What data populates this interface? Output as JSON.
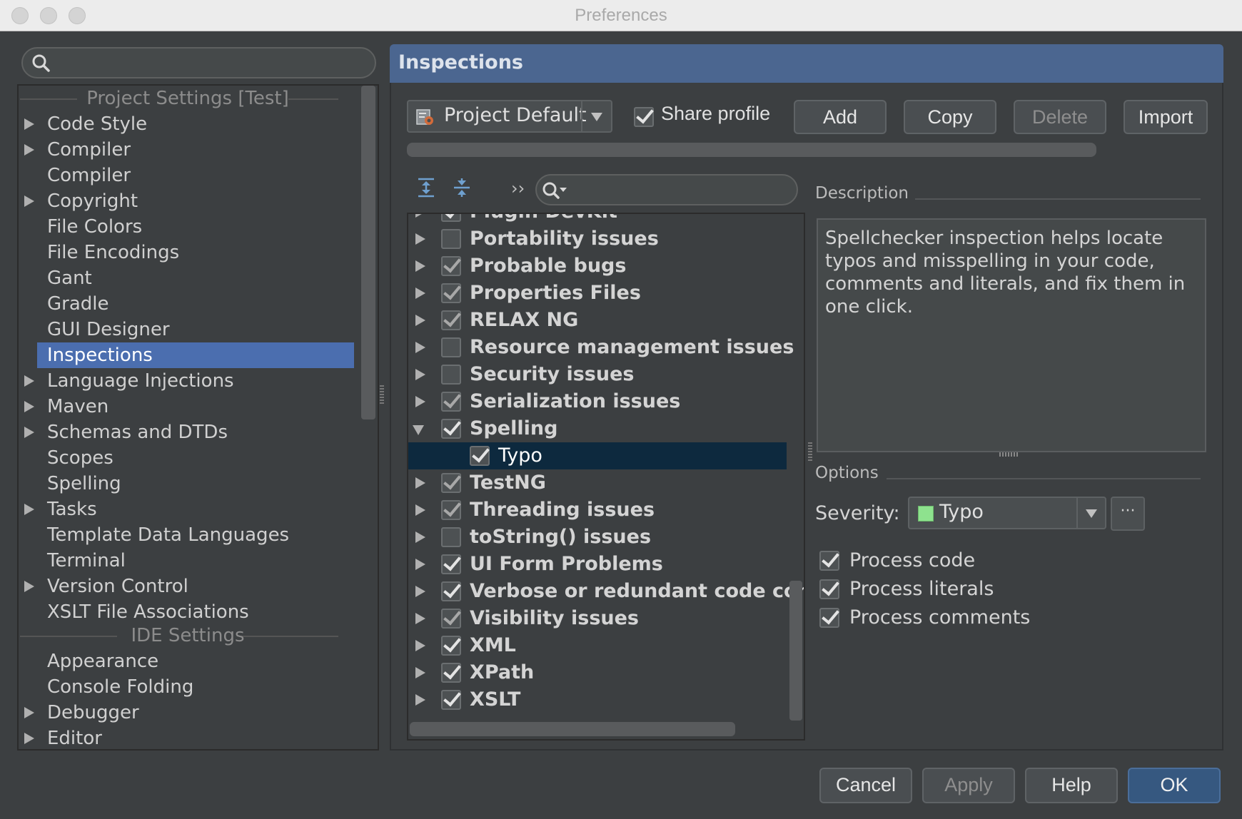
{
  "window": {
    "title": "Preferences"
  },
  "left": {
    "search_placeholder": "",
    "project_header": "Project Settings [Test]",
    "ide_header": "IDE Settings",
    "project_items": [
      {
        "label": "Code Style",
        "expandable": true
      },
      {
        "label": "Compiler",
        "expandable": true
      },
      {
        "label": "Compiler",
        "expandable": false
      },
      {
        "label": "Copyright",
        "expandable": true
      },
      {
        "label": "File Colors",
        "expandable": false
      },
      {
        "label": "File Encodings",
        "expandable": false
      },
      {
        "label": "Gant",
        "expandable": false
      },
      {
        "label": "Gradle",
        "expandable": false
      },
      {
        "label": "GUI Designer",
        "expandable": false
      },
      {
        "label": "Inspections",
        "expandable": false,
        "selected": true
      },
      {
        "label": "Language Injections",
        "expandable": true
      },
      {
        "label": "Maven",
        "expandable": true
      },
      {
        "label": "Schemas and DTDs",
        "expandable": true
      },
      {
        "label": "Scopes",
        "expandable": false
      },
      {
        "label": "Spelling",
        "expandable": false
      },
      {
        "label": "Tasks",
        "expandable": true
      },
      {
        "label": "Template Data Languages",
        "expandable": false
      },
      {
        "label": "Terminal",
        "expandable": false
      },
      {
        "label": "Version Control",
        "expandable": true
      },
      {
        "label": "XSLT File Associations",
        "expandable": false
      }
    ],
    "ide_items": [
      {
        "label": "Appearance",
        "expandable": false
      },
      {
        "label": "Console Folding",
        "expandable": false
      },
      {
        "label": "Debugger",
        "expandable": true
      },
      {
        "label": "Editor",
        "expandable": true
      }
    ]
  },
  "panel": {
    "title": "Inspections",
    "profile": "Project Default",
    "share_profile_label": "Share profile",
    "share_profile_checked": true,
    "buttons": {
      "add": "Add",
      "copy": "Copy",
      "delete": "Delete",
      "import": "Import"
    },
    "tree_search_placeholder": "",
    "more_glyph": "››",
    "inspections": [
      {
        "label": "Plugin DevKit",
        "checked": true,
        "dim": false
      },
      {
        "label": "Portability issues",
        "checked": false,
        "dim": false
      },
      {
        "label": "Probable bugs",
        "checked": true,
        "dim": true
      },
      {
        "label": "Properties Files",
        "checked": true,
        "dim": true
      },
      {
        "label": "RELAX NG",
        "checked": true,
        "dim": true
      },
      {
        "label": "Resource management issues",
        "checked": false,
        "dim": false
      },
      {
        "label": "Security issues",
        "checked": false,
        "dim": false
      },
      {
        "label": "Serialization issues",
        "checked": true,
        "dim": true
      },
      {
        "label": "Spelling",
        "checked": true,
        "dim": false,
        "expanded": true
      },
      {
        "label": "Typo",
        "checked": true,
        "dim": false,
        "child": true,
        "selected": true
      },
      {
        "label": "TestNG",
        "checked": true,
        "dim": true
      },
      {
        "label": "Threading issues",
        "checked": true,
        "dim": true
      },
      {
        "label": "toString() issues",
        "checked": false,
        "dim": false
      },
      {
        "label": "UI Form Problems",
        "checked": true,
        "dim": false
      },
      {
        "label": "Verbose or redundant code const",
        "checked": true,
        "dim": false
      },
      {
        "label": "Visibility issues",
        "checked": true,
        "dim": true
      },
      {
        "label": "XML",
        "checked": true,
        "dim": false
      },
      {
        "label": "XPath",
        "checked": true,
        "dim": false
      },
      {
        "label": "XSLT",
        "checked": true,
        "dim": false
      }
    ],
    "description_label": "Description",
    "description_text": "Spellchecker inspection helps locate typos and misspelling in your code, comments and literals, and fix them in one click.",
    "options_label": "Options",
    "severity_label": "Severity:",
    "severity_value": "Typo",
    "severity_color": "#8ee28e",
    "severity_more": "···",
    "options": [
      {
        "label": "Process code",
        "checked": true
      },
      {
        "label": "Process literals",
        "checked": true
      },
      {
        "label": "Process comments",
        "checked": true
      }
    ]
  },
  "footer": {
    "cancel": "Cancel",
    "apply": "Apply",
    "help": "Help",
    "ok": "OK"
  },
  "colors": {
    "selection": "#4b6eaf",
    "header": "#4b6690",
    "tree_selection": "#0d293e"
  }
}
